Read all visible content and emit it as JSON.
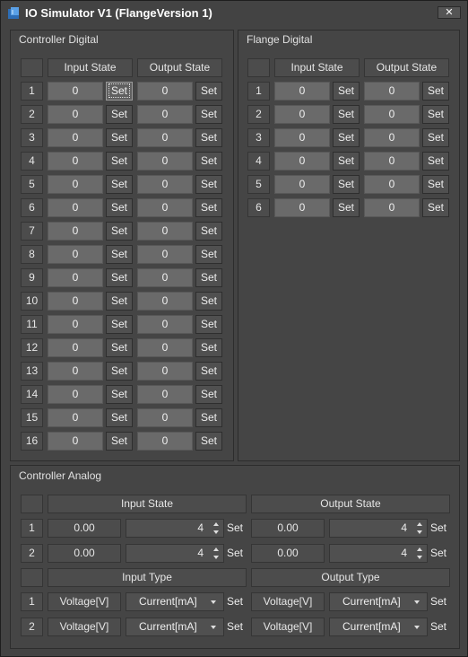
{
  "window": {
    "title": "IO Simulator V1 (FlangeVersion 1)",
    "close_label": "✕"
  },
  "controller_digital": {
    "title": "Controller Digital",
    "headers": {
      "input": "Input State",
      "output": "Output State"
    },
    "rows": [
      {
        "n": "1",
        "in": "0",
        "out": "0"
      },
      {
        "n": "2",
        "in": "0",
        "out": "0"
      },
      {
        "n": "3",
        "in": "0",
        "out": "0"
      },
      {
        "n": "4",
        "in": "0",
        "out": "0"
      },
      {
        "n": "5",
        "in": "0",
        "out": "0"
      },
      {
        "n": "6",
        "in": "0",
        "out": "0"
      },
      {
        "n": "7",
        "in": "0",
        "out": "0"
      },
      {
        "n": "8",
        "in": "0",
        "out": "0"
      },
      {
        "n": "9",
        "in": "0",
        "out": "0"
      },
      {
        "n": "10",
        "in": "0",
        "out": "0"
      },
      {
        "n": "11",
        "in": "0",
        "out": "0"
      },
      {
        "n": "12",
        "in": "0",
        "out": "0"
      },
      {
        "n": "13",
        "in": "0",
        "out": "0"
      },
      {
        "n": "14",
        "in": "0",
        "out": "0"
      },
      {
        "n": "15",
        "in": "0",
        "out": "0"
      },
      {
        "n": "16",
        "in": "0",
        "out": "0"
      }
    ],
    "set_label": "Set"
  },
  "flange_digital": {
    "title": "Flange Digital",
    "headers": {
      "input": "Input State",
      "output": "Output State"
    },
    "rows": [
      {
        "n": "1",
        "in": "0",
        "out": "0"
      },
      {
        "n": "2",
        "in": "0",
        "out": "0"
      },
      {
        "n": "3",
        "in": "0",
        "out": "0"
      },
      {
        "n": "4",
        "in": "0",
        "out": "0"
      },
      {
        "n": "5",
        "in": "0",
        "out": "0"
      },
      {
        "n": "6",
        "in": "0",
        "out": "0"
      }
    ],
    "set_label": "Set"
  },
  "controller_analog": {
    "title": "Controller Analog",
    "state_headers": {
      "input": "Input State",
      "output": "Output State"
    },
    "state_rows": [
      {
        "n": "1",
        "in_val": "0.00",
        "in_spin": "4",
        "out_val": "0.00",
        "out_spin": "4"
      },
      {
        "n": "2",
        "in_val": "0.00",
        "in_spin": "4",
        "out_val": "0.00",
        "out_spin": "4"
      }
    ],
    "type_headers": {
      "input": "Input Type",
      "output": "Output Type"
    },
    "type_rows": [
      {
        "n": "1",
        "in_type": "Voltage[V]",
        "in_combo": "Current[mA]",
        "out_type": "Voltage[V]",
        "out_combo": "Current[mA]"
      },
      {
        "n": "2",
        "in_type": "Voltage[V]",
        "in_combo": "Current[mA]",
        "out_type": "Voltage[V]",
        "out_combo": "Current[mA]"
      }
    ],
    "set_label": "Set"
  }
}
